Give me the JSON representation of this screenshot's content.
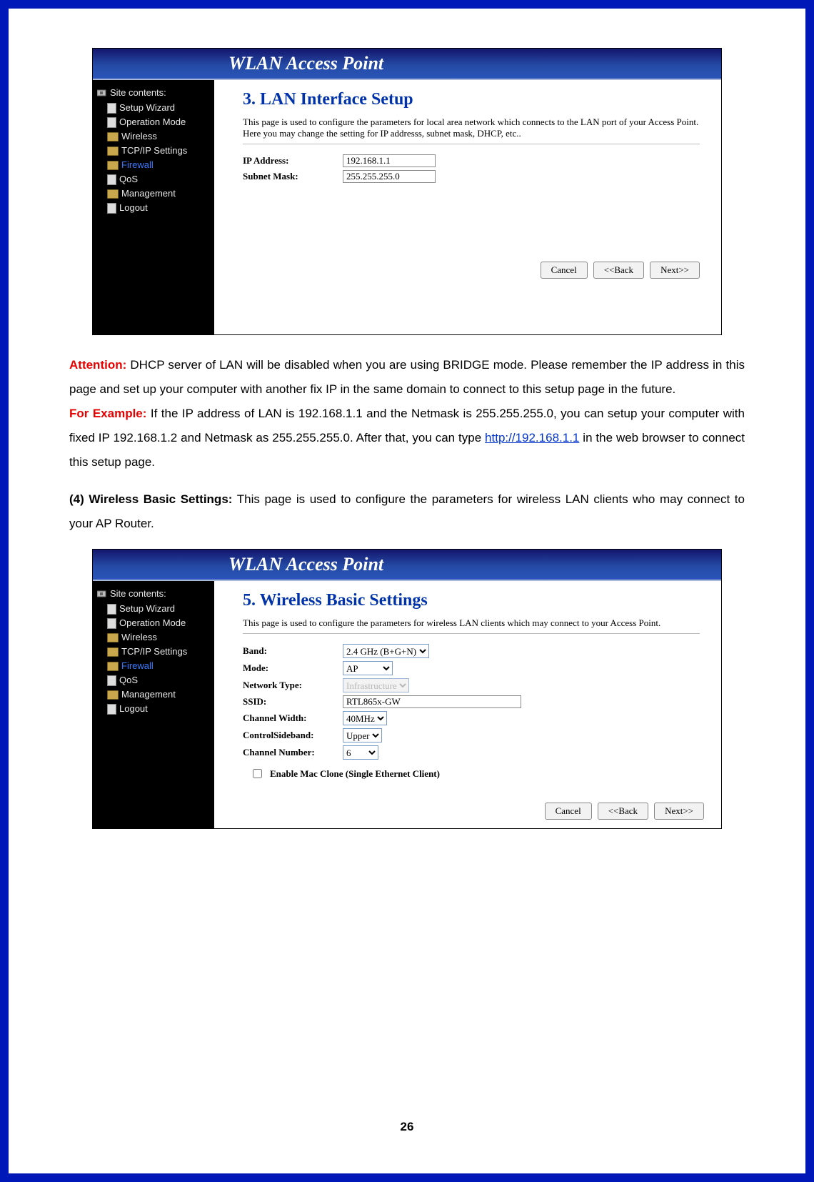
{
  "page_number": "26",
  "ap_title": "WLAN Access Point",
  "sidebar": {
    "root": "Site contents:",
    "items": [
      {
        "label": "Setup Wizard",
        "type": "doc"
      },
      {
        "label": "Operation Mode",
        "type": "doc"
      },
      {
        "label": "Wireless",
        "type": "folder"
      },
      {
        "label": "TCP/IP Settings",
        "type": "folder"
      },
      {
        "label": "Firewall",
        "type": "folder",
        "highlight": true
      },
      {
        "label": "QoS",
        "type": "doc"
      },
      {
        "label": "Management",
        "type": "folder"
      },
      {
        "label": "Logout",
        "type": "doc"
      }
    ]
  },
  "lan": {
    "title": "3. LAN Interface Setup",
    "desc": "This page is used to configure the parameters for local area network which connects to the LAN port of your Access Point. Here you may change the setting for IP addresss, subnet mask, DHCP, etc..",
    "ip_label": "IP Address:",
    "ip_value": "192.168.1.1",
    "mask_label": "Subnet Mask:",
    "mask_value": "255.255.255.0"
  },
  "buttons": {
    "cancel": "Cancel",
    "back": "<<Back",
    "next": "Next>>"
  },
  "paragraphs": {
    "attention_label": "Attention:",
    "attention_text": " DHCP server of LAN will be disabled when you are using BRIDGE mode. Please remember the IP address in this page and set up your computer with another fix IP in the same domain to connect to this setup page in the future.",
    "example_label": "For Example:",
    "example_text_before_link": " If the IP address of LAN is 192.168.1.1 and the Netmask is 255.255.255.0, you can setup your computer with fixed IP 192.168.1.2 and Netmask as 255.255.255.0. After that, you can type ",
    "example_link_text": "http://192.168.1.1",
    "example_text_after_link": " in the web browser to connect this setup page.",
    "section4_label": "(4) Wireless Basic Settings:",
    "section4_text": " This page is used to configure the parameters for wireless LAN clients who may connect to your AP Router."
  },
  "wireless": {
    "title": "5. Wireless Basic Settings",
    "desc": "This page is used to configure the parameters for wireless LAN clients which may connect to your Access Point.",
    "band_label": "Band:",
    "band_value": "2.4 GHz (B+G+N)",
    "mode_label": "Mode:",
    "mode_value": "AP",
    "nettype_label": "Network Type:",
    "nettype_value": "Infrastructure",
    "ssid_label": "SSID:",
    "ssid_value": "RTL865x-GW",
    "chwidth_label": "Channel Width:",
    "chwidth_value": "40MHz",
    "sideband_label": "ControlSideband:",
    "sideband_value": "Upper",
    "chnum_label": "Channel Number:",
    "chnum_value": "6",
    "mac_clone_label": "Enable Mac Clone (Single Ethernet Client)"
  }
}
